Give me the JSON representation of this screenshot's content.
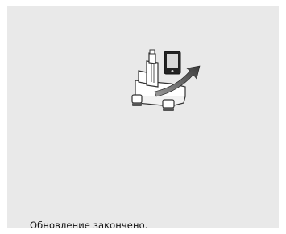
{
  "screen": {
    "background": "#e9e9e9",
    "illustration": "embroidery-machine-update-icon",
    "status_message": "Обновление закончено."
  }
}
